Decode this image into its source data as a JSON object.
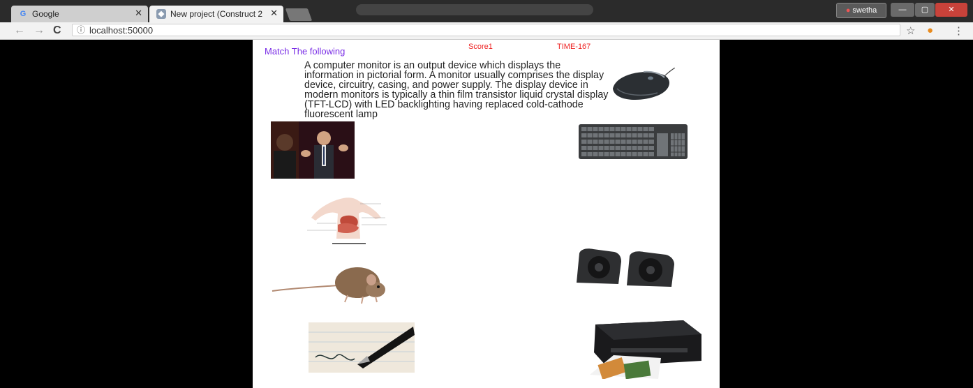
{
  "browser": {
    "tabs": [
      {
        "title": "Google",
        "active": false
      },
      {
        "title": "New project (Construct 2",
        "active": true
      }
    ],
    "user": "swetha",
    "url": "localhost:50000"
  },
  "game": {
    "heading": "Match The following",
    "score": "Score1",
    "time": "TIME-167",
    "description": "A computer monitor is an output device which displays the information in pictorial form. A monitor usually comprises the display device, circuitry, casing, and power supply. The display device in modern monitors is typically a thin film transistor liquid crystal display (TFT-LCD) with LED backlighting having replaced cold-cathode fluorescent lamp"
  }
}
